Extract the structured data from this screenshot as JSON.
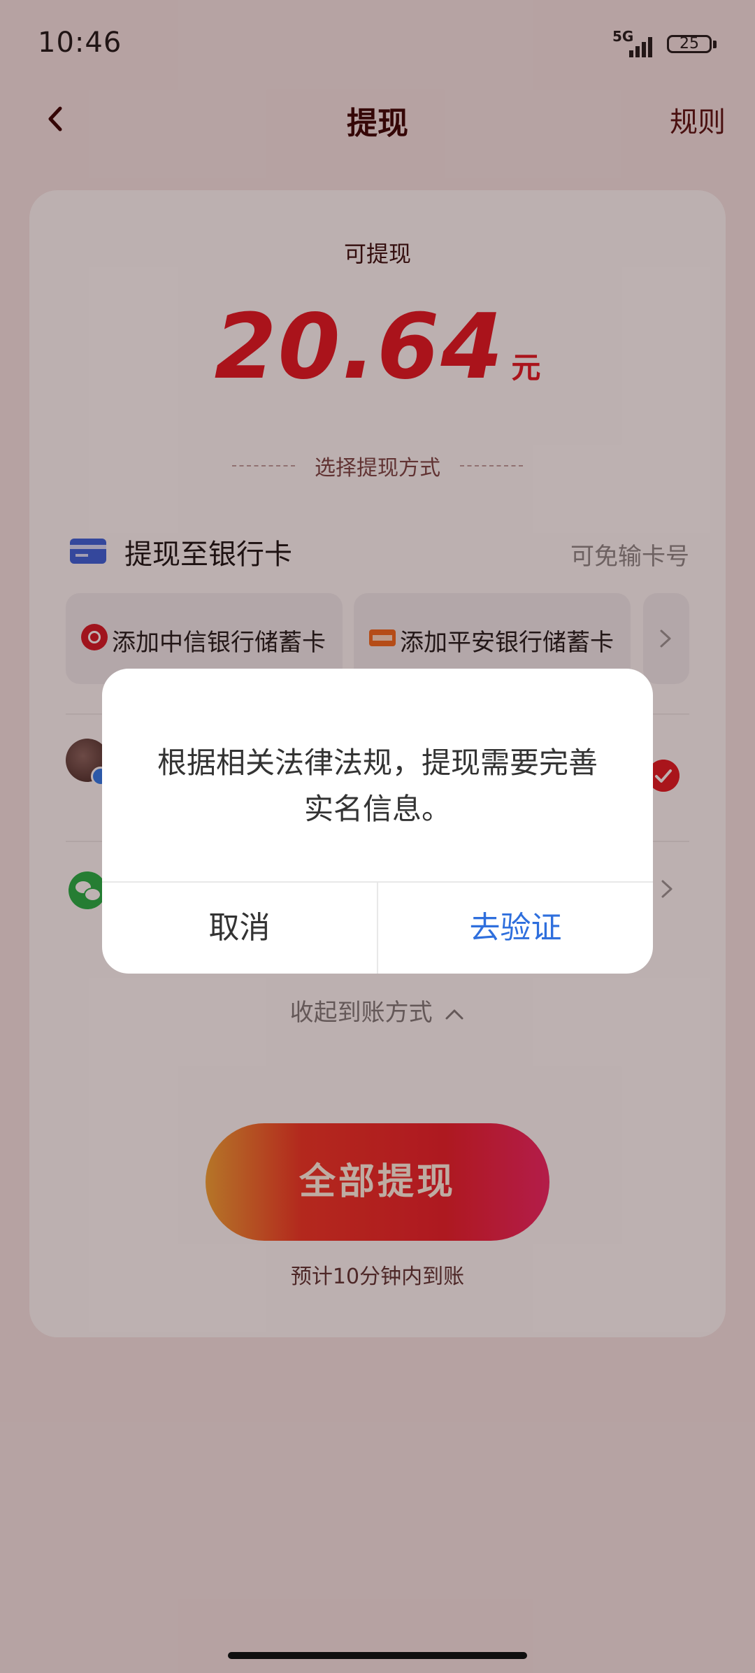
{
  "status_bar": {
    "time": "10:46",
    "network": "5G",
    "battery": "25"
  },
  "header": {
    "title": "提现",
    "rules": "规则"
  },
  "card": {
    "available_label": "可提现",
    "amount": "20.64",
    "unit": "元",
    "method_label": "选择提现方式",
    "bank_section_title": "提现至银行卡",
    "bank_section_hint": "可免输卡号",
    "bank_options": [
      "添加中信银行储蓄卡",
      "添加平安银行储蓄卡"
    ],
    "collapse_label": "收起到账方式",
    "cta_label": "全部提现",
    "eta_note": "预计10分钟内到账"
  },
  "dialog": {
    "message": "根据相关法律法规，提现需要完善实名信息。",
    "cancel": "取消",
    "confirm": "去验证"
  },
  "colors": {
    "accent_red": "#e21c28",
    "link_blue": "#2f6fdd",
    "bank_blue": "#3a66e0",
    "wechat_green": "#24b34a"
  }
}
